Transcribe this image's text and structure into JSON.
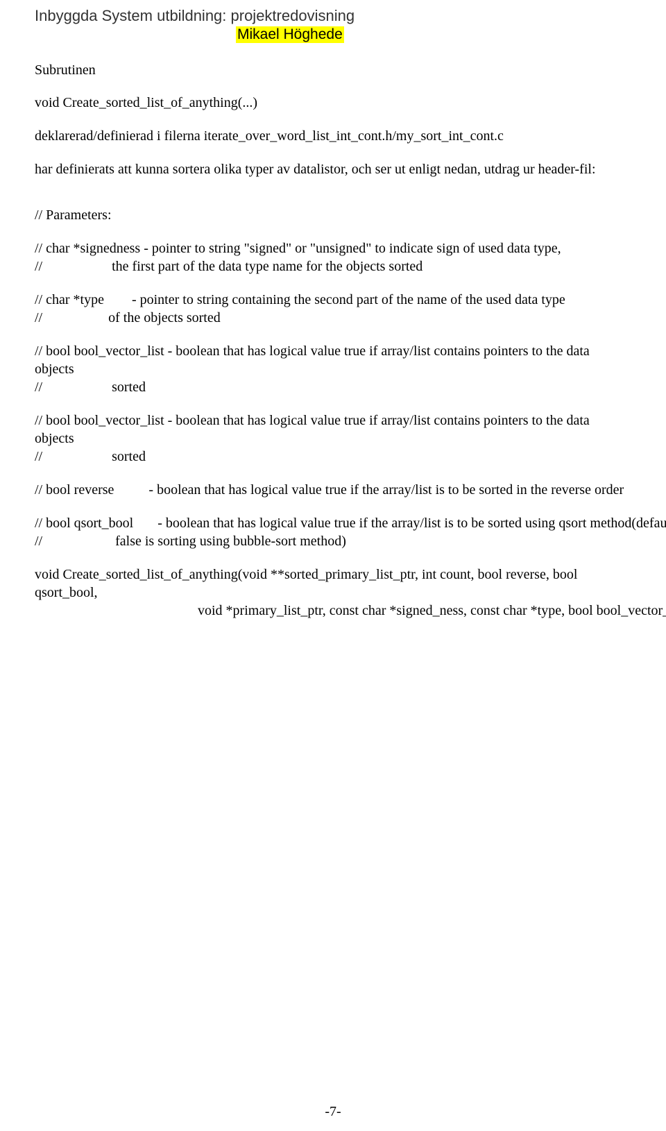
{
  "header": {
    "title": "Inbyggda System utbildning: projektredovisning",
    "author": "Mikael Höghede"
  },
  "sections": {
    "subheading": "Subrutinen",
    "func_name": "void Create_sorted_list_of_anything(...)",
    "declared_in": "deklarerad/definierad i filerna iterate_over_word_list_int_cont.h/my_sort_int_cont.c",
    "purpose": "har definierats att kunna sortera olika typer av datalistor, och ser ut enligt nedan, utdrag ur header-fil:",
    "params_header": "// Parameters:",
    "param_signedness_1": "// char *signedness - pointer to string \"signed\" or \"unsigned\" to indicate sign of used data type,",
    "param_signedness_2": "//                    the first part of the data type name for the objects sorted",
    "param_type_1": "// char *type        - pointer to string containing the second part of the name of the used data type",
    "param_type_2": "//                   of the objects sorted",
    "param_bool_vector_1a": "// bool bool_vector_list - boolean that has logical value true if array/list contains pointers to the data objects",
    "param_bool_vector_1b": "//                    sorted",
    "param_bool_vector_2a": "// bool bool_vector_list - boolean that has logical value true if array/list contains pointers to the data objects",
    "param_bool_vector_2b": "//                    sorted",
    "param_reverse_1": "// bool reverse          - boolean that has logical value true if the array/list is to be sorted in the reverse order",
    "param_qsort_1": "// bool qsort_bool       - boolean that has logical value true if the array/list is to be sorted using qsort method(default when",
    "param_qsort_2": "//                     false is sorting using bubble-sort method)",
    "signature_1": "void Create_sorted_list_of_anything(void **sorted_primary_list_ptr, int count, bool reverse, bool qsort_bool,",
    "signature_2": "                                               void *primary_list_ptr, const char *signed_ness, const char *type, bool bool_vector_list  );"
  },
  "page_number": "-7-"
}
